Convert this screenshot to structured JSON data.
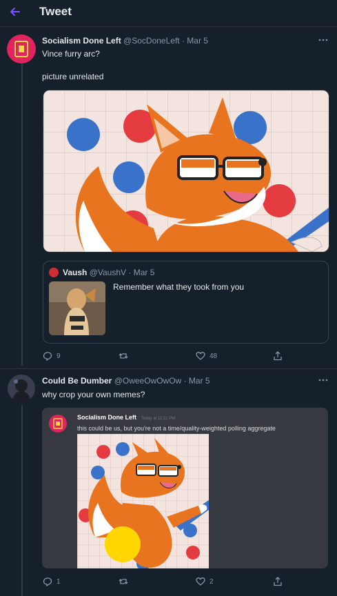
{
  "header": {
    "title": "Tweet"
  },
  "tweet1": {
    "name": "Socialism Done Left",
    "handle": "@SocDoneLeft",
    "date": "· Mar 5",
    "line1": "Vince furry arc?",
    "line2": "picture unrelated",
    "image_icon": "fox-with-glasses-illustration",
    "quote": {
      "name": "Vaush",
      "handle": "@VaushV",
      "date": "· Mar 5",
      "text": "Remember what they took from you"
    },
    "actions": {
      "reply_count": "9",
      "retweet_count": "",
      "like_count": "48"
    }
  },
  "tweet2": {
    "name": "Could Be Dumber",
    "handle": "@OweeOwOwOw",
    "date": "· Mar 5",
    "text": "why crop your own memes?",
    "discord": {
      "name": "Socialism Done Left",
      "timestamp": "Today at 11:21 PM",
      "message": "this could be us, but you're not a time/quality-weighted polling aggregate"
    },
    "actions": {
      "reply_count": "1",
      "retweet_count": "",
      "like_count": "2"
    }
  },
  "colors": {
    "background": "#15202b",
    "accent": "#7856ff",
    "muted": "#8b98a5",
    "brand_red": "#e0245e",
    "discord_bg": "#36393f"
  }
}
